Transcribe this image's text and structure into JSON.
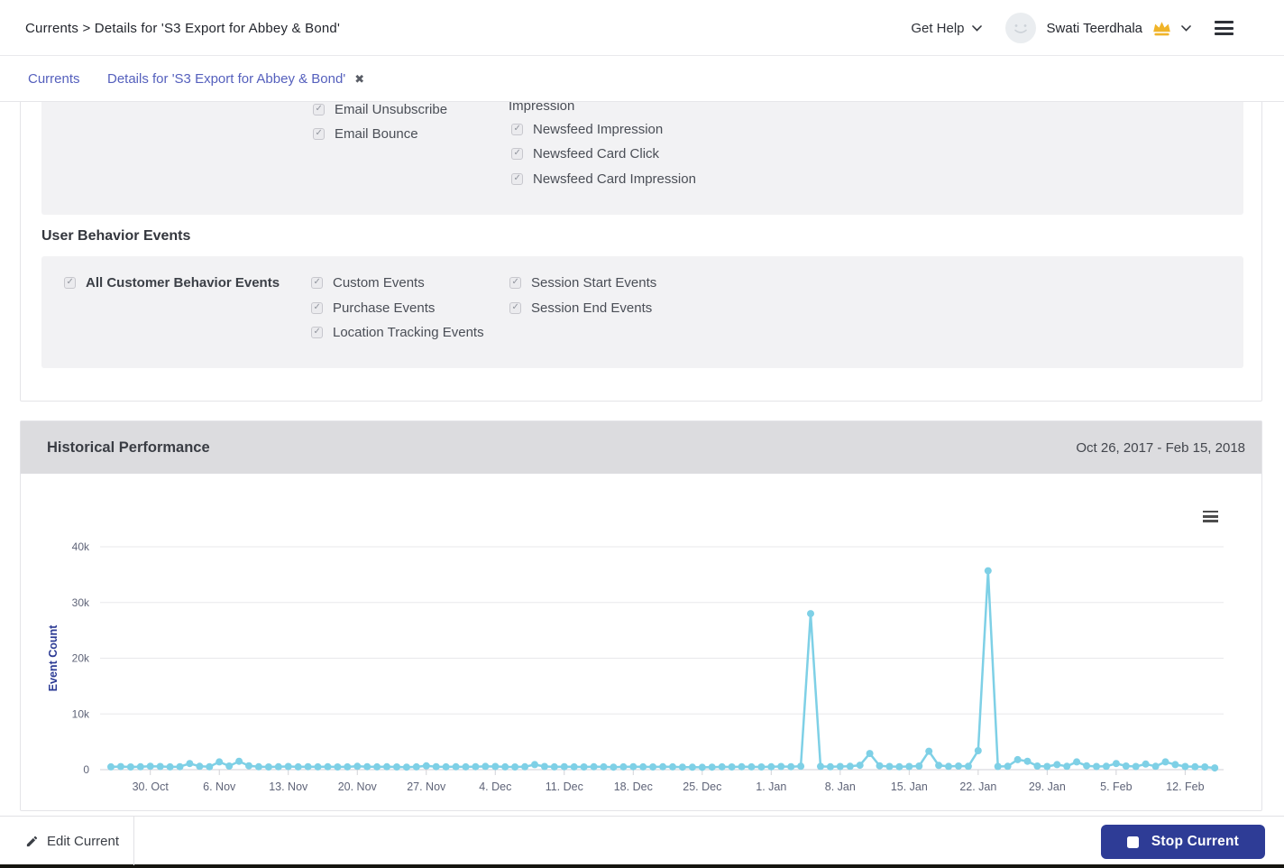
{
  "header": {
    "breadcrumb": "Currents > Details for 'S3 Export for Abbey & Bond'",
    "get_help_label": "Get Help",
    "user_name": "Swati Teerdhala"
  },
  "tab_bar": {
    "tab_currents": "Currents",
    "tab_details": "Details for 'S3 Export for Abbey & Bond'",
    "close_icon": "✖"
  },
  "message_events": {
    "partial_top_label": "Impression",
    "email_items": [
      "Email Unsubscribe",
      "Email Bounce"
    ],
    "newsfeed_items": [
      "Newsfeed Impression",
      "Newsfeed Card Click",
      "Newsfeed Card Impression"
    ]
  },
  "user_behavior_events": {
    "heading": "User Behavior Events",
    "all_events_label": "All Customer Behavior Events",
    "column2": [
      "Custom Events",
      "Purchase Events",
      "Location Tracking Events"
    ],
    "column3": [
      "Session Start Events",
      "Session End Events"
    ]
  },
  "historical_performance": {
    "title": "Historical Performance",
    "date_range": "Oct 26, 2017 - Feb 15, 2018"
  },
  "footer": {
    "edit_button": "Edit Current",
    "stop_button": "Stop Current"
  },
  "colors": {
    "accent_navy": "#2b3a94",
    "tab_blue": "#5560bd",
    "chart_line": "#7ed0e6",
    "crown_gold": "#f0b429",
    "header_bar_gray": "#dcdcdf",
    "panel_gray": "#f2f2f4",
    "stop_button_bg": "#2e3c96"
  },
  "chart_data": {
    "type": "line",
    "title": "",
    "xlabel": "",
    "ylabel": "Event Count",
    "ylim": [
      0,
      40000
    ],
    "grid": true,
    "legend": false,
    "series_name": "Event Count",
    "series_color": "#7ed0e6",
    "x_start_date": "2017-10-26",
    "x_end_date": "2018-02-15",
    "x_unit": "day",
    "yticks": [
      {
        "v": 0,
        "label": "0"
      },
      {
        "v": 10000,
        "label": "10k"
      },
      {
        "v": 20000,
        "label": "20k"
      },
      {
        "v": 30000,
        "label": "30k"
      },
      {
        "v": 40000,
        "label": "40k"
      }
    ],
    "xticks": [
      {
        "i": 4,
        "label": "30. Oct"
      },
      {
        "i": 11,
        "label": "6. Nov"
      },
      {
        "i": 18,
        "label": "13. Nov"
      },
      {
        "i": 25,
        "label": "20. Nov"
      },
      {
        "i": 32,
        "label": "27. Nov"
      },
      {
        "i": 39,
        "label": "4. Dec"
      },
      {
        "i": 46,
        "label": "11. Dec"
      },
      {
        "i": 53,
        "label": "18. Dec"
      },
      {
        "i": 60,
        "label": "25. Dec"
      },
      {
        "i": 67,
        "label": "1. Jan"
      },
      {
        "i": 74,
        "label": "8. Jan"
      },
      {
        "i": 81,
        "label": "15. Jan"
      },
      {
        "i": 88,
        "label": "22. Jan"
      },
      {
        "i": 95,
        "label": "29. Jan"
      },
      {
        "i": 102,
        "label": "5. Feb"
      },
      {
        "i": 109,
        "label": "12. Feb"
      }
    ],
    "values": [
      500,
      550,
      480,
      520,
      620,
      560,
      500,
      540,
      1100,
      600,
      520,
      1400,
      650,
      1500,
      700,
      520,
      480,
      520,
      560,
      500,
      540,
      500,
      520,
      480,
      500,
      600,
      540,
      500,
      520,
      480,
      460,
      500,
      680,
      540,
      500,
      520,
      500,
      540,
      580,
      560,
      500,
      480,
      520,
      900,
      560,
      500,
      540,
      500,
      480,
      520,
      500,
      460,
      500,
      540,
      500,
      480,
      520,
      500,
      460,
      440,
      420,
      460,
      500,
      480,
      520,
      500,
      480,
      520,
      560,
      540,
      620,
      28000,
      580,
      520,
      560,
      600,
      800,
      2900,
      700,
      560,
      520,
      560,
      640,
      3300,
      760,
      580,
      640,
      600,
      3400,
      35700,
      560,
      600,
      1800,
      1500,
      640,
      560,
      900,
      600,
      1400,
      700,
      560,
      600,
      1100,
      640,
      560,
      1000,
      600,
      1400,
      900,
      560,
      520,
      480,
      300
    ]
  }
}
